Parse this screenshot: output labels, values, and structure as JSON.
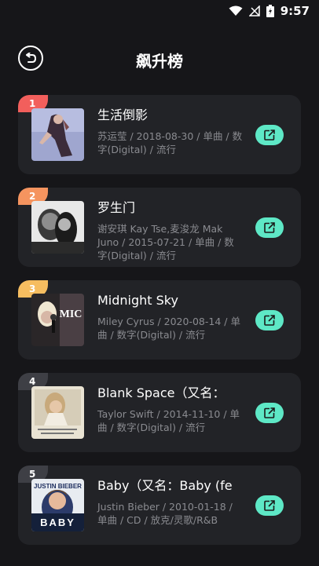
{
  "status_bar": {
    "time": "9:57"
  },
  "header": {
    "title": "飙升榜"
  },
  "songs": [
    {
      "rank": "1",
      "title": "生活倒影",
      "meta": "苏运莹 / 2018-08-30 / 单曲 / 数字(Digital) / 流行",
      "badge_color": "#f25f5c"
    },
    {
      "rank": "2",
      "title": "罗生门",
      "meta": "谢安琪 Kay Tse,麦浚龙 Mak Juno / 2015-07-21 / 单曲 / 数字(Digital) / 流行",
      "badge_color": "#f5945f"
    },
    {
      "rank": "3",
      "title": "Midnight Sky",
      "meta": "Miley Cyrus / 2020-08-14 / 单曲 / 数字(Digital) / 流行",
      "badge_color": "#f6bd60"
    },
    {
      "rank": "4",
      "title": "Blank Space（又名：",
      "meta": "Taylor Swift / 2014-11-10 / 单曲 / 数字(Digital) / 流行",
      "badge_color": "#3e3f45"
    },
    {
      "rank": "5",
      "title": "Baby（又名：Baby (fe",
      "meta": "Justin Bieber / 2010-01-18 / 单曲 / CD / 放克/灵歌/R&B",
      "badge_color": "#3e3f45"
    }
  ],
  "covers": {
    "c5_text_top": "JUSTIN BIEBER",
    "c5_text_bottom": "BABY",
    "c3_text": "MIC"
  }
}
